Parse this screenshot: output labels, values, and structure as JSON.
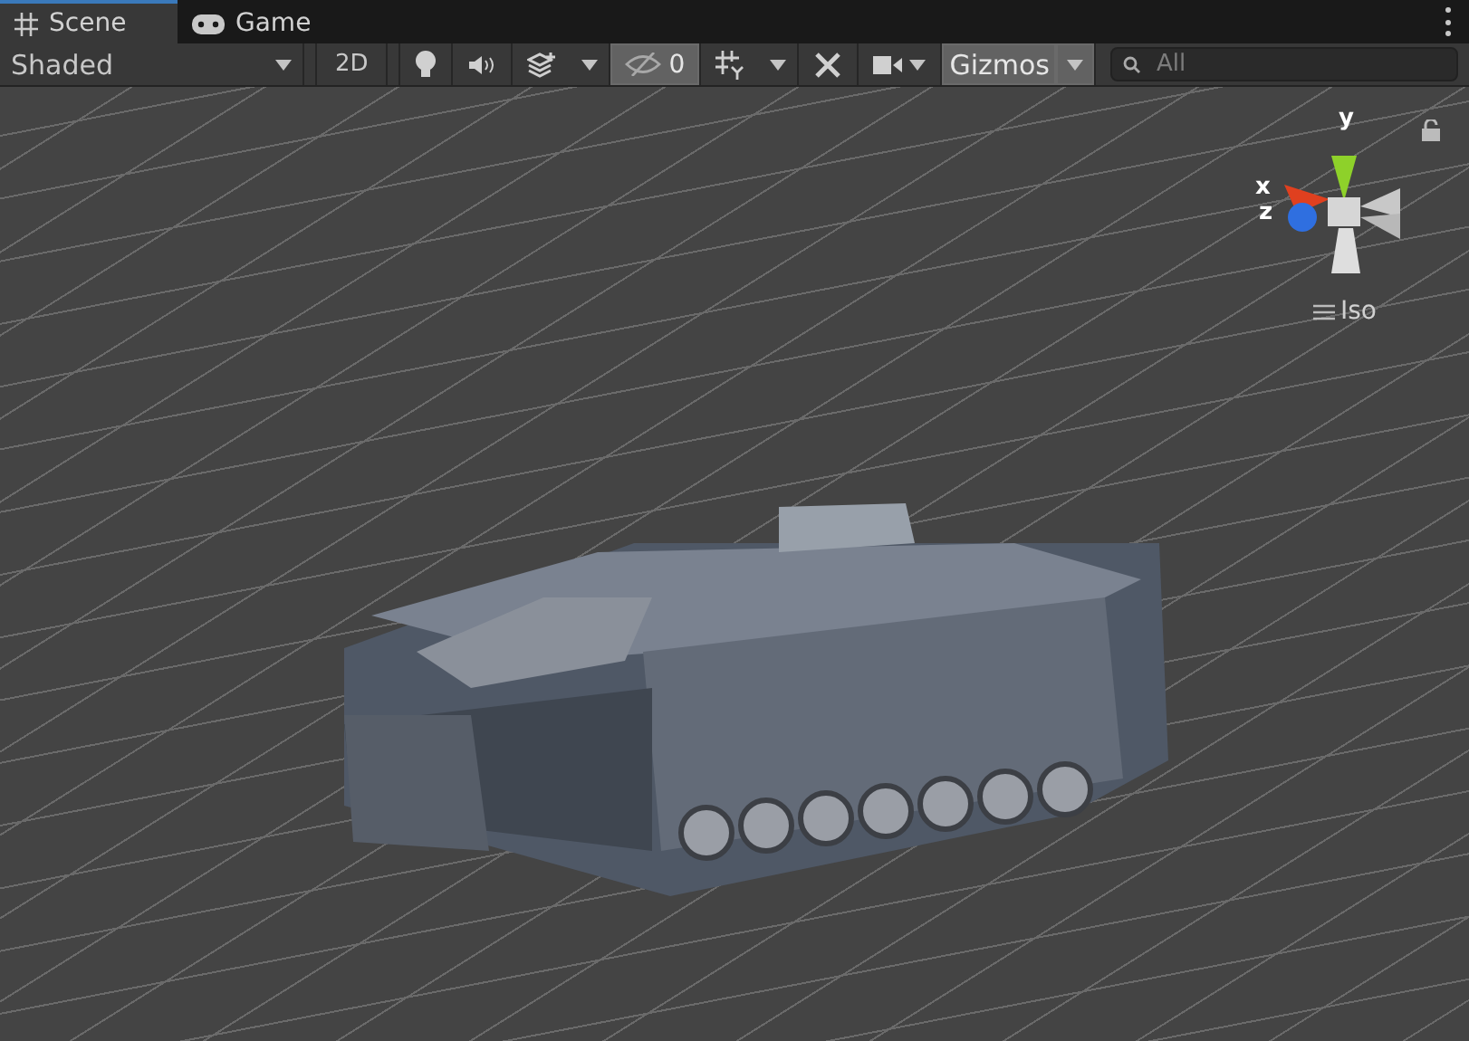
{
  "tabs": [
    {
      "label": "Scene",
      "selected": true
    },
    {
      "label": "Game",
      "selected": false
    }
  ],
  "toolbar": {
    "shading": "Shaded",
    "mode_2d": {
      "label": "2D",
      "on": false
    },
    "hidden_count": {
      "label": "0"
    },
    "gizmos": {
      "label": "Gizmos",
      "on": true
    },
    "search": {
      "placeholder": "All"
    }
  },
  "orientation_gizmo": {
    "axes": [
      {
        "label": "y",
        "color": "#8ed12a"
      },
      {
        "label": "x",
        "color": "#e0401f"
      },
      {
        "label": "z",
        "color": "#2f6fe0"
      }
    ],
    "projection": "Iso"
  }
}
